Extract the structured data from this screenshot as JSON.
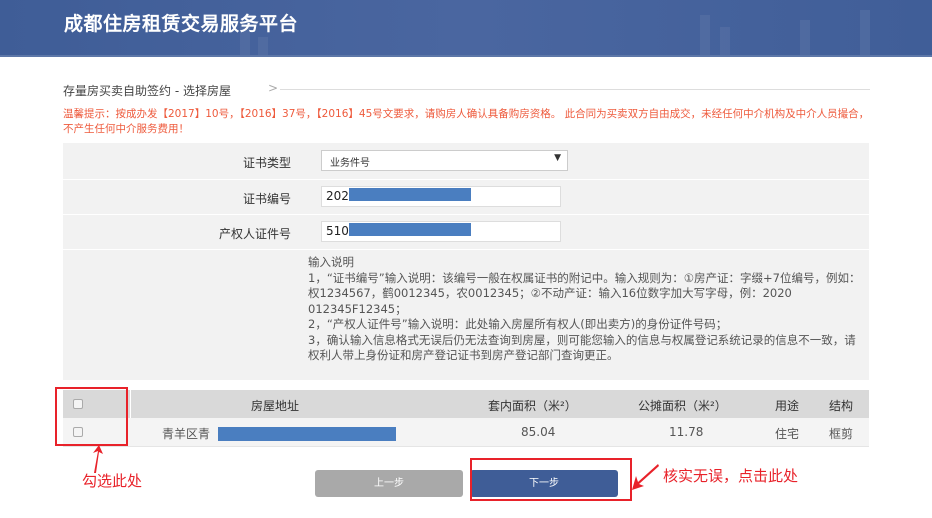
{
  "header": {
    "title": "成都住房租赁交易服务平台"
  },
  "breadcrumb": {
    "label": "存量房买卖自助签约 - 选择房屋",
    "arrow": ">"
  },
  "notice": "温馨提示：按成办发【2017】10号，【2016】37号，【2016】45号文要求，请购房人确认具备购房资格。 此合同为买卖双方自由成交，未经任何中介机构及中介人员撮合，不产生任何中介服务费用！",
  "form": {
    "cert_type": {
      "label": "证书类型",
      "value": "业务件号",
      "caret": "▼"
    },
    "cert_no": {
      "label": "证书编号",
      "value": "202"
    },
    "owner_id": {
      "label": "产权人证件号",
      "value": "510"
    },
    "help": {
      "title": "输入说明",
      "lines": [
        "1，“证书编号”输入说明：该编号一般在权属证书的附记中。输入规则为：①房产证：字缀+7位编号，例如：权1234567，鹤0012345，农0012345；②不动产证：输入16位数字加大写字母，例：2020 012345F12345；",
        "2，“产权人证件号”输入说明：此处输入房屋所有权人(即出卖方)的身份证件号码；",
        "3，确认输入信息格式无误后仍无法查询到房屋，则可能您输入的信息与权属登记系统记录的信息不一致，请权利人带上身份证和房产登记证书到房产登记部门查询更正。"
      ]
    }
  },
  "table": {
    "headers": [
      "房屋地址",
      "套内面积（米²）",
      "公摊面积（米²）",
      "用途",
      "结构"
    ],
    "rows": [
      {
        "address": "青羊区青",
        "inner_area": "85.04",
        "shared_area": "11.78",
        "usage": "住宅",
        "structure": "框剪"
      }
    ]
  },
  "buttons": {
    "prev": "上一步",
    "next": "下一步"
  },
  "annotations": {
    "check": "勾选此处",
    "click": "核实无误，点击此处"
  },
  "colors": {
    "brand": "#3f5d97",
    "warning": "#ee5a3c",
    "annotation": "#e8222a"
  }
}
